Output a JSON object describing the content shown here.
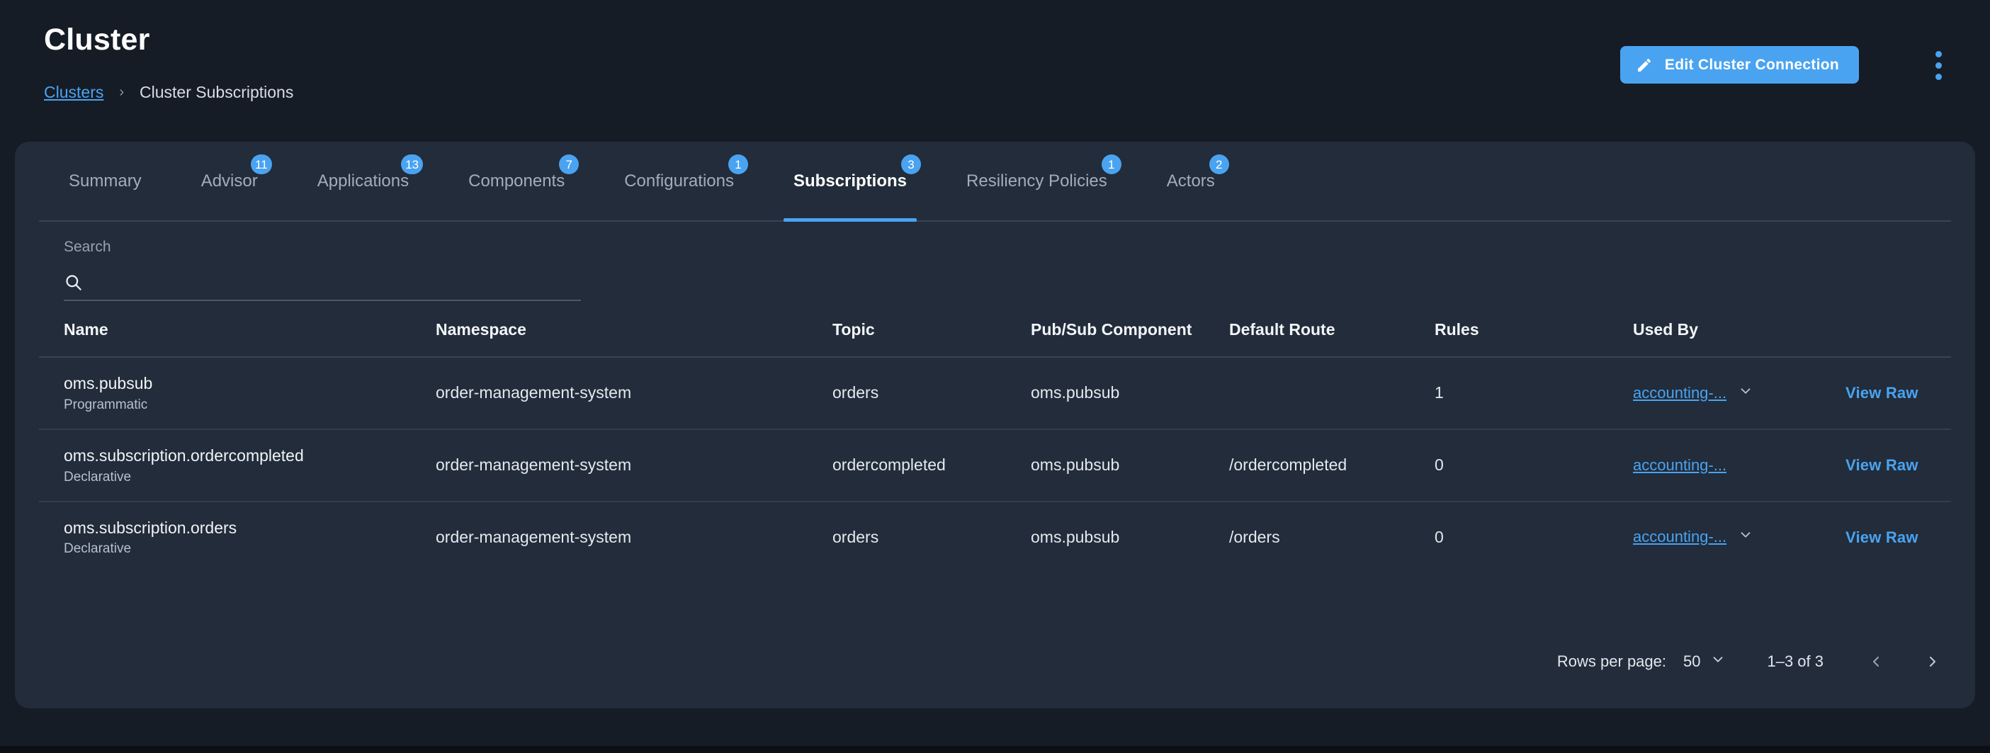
{
  "header": {
    "title": "Cluster",
    "breadcrumb": {
      "root": "Clusters",
      "separator": "›",
      "current": "Cluster Subscriptions"
    },
    "edit_button": {
      "label": "Edit Cluster Connection",
      "icon": "pencil-icon",
      "color": "#4aa3f0"
    },
    "kebab_icon": "more-vertical-icon"
  },
  "tabs": [
    {
      "label": "Summary",
      "badge": "",
      "active": false
    },
    {
      "label": "Advisor",
      "badge": "11",
      "active": false
    },
    {
      "label": "Applications",
      "badge": "13",
      "active": false
    },
    {
      "label": "Components",
      "badge": "7",
      "active": false
    },
    {
      "label": "Configurations",
      "badge": "1",
      "active": false
    },
    {
      "label": "Subscriptions",
      "badge": "3",
      "active": true
    },
    {
      "label": "Resiliency Policies",
      "badge": "1",
      "active": false
    },
    {
      "label": "Actors",
      "badge": "2",
      "active": false
    }
  ],
  "search": {
    "label": "Search",
    "value": "",
    "placeholder": "",
    "icon": "search-icon"
  },
  "table": {
    "columns": [
      "Name",
      "Namespace",
      "Topic",
      "Pub/Sub Component",
      "Default Route",
      "Rules",
      "Used By",
      ""
    ],
    "rows": [
      {
        "name": "oms.pubsub",
        "kind": "Programmatic",
        "namespace": "order-management-system",
        "topic": "orders",
        "pubsub_component": "oms.pubsub",
        "default_route": "",
        "rules": "1",
        "used_by": "accounting-...",
        "has_chevron": true,
        "view_raw": "View Raw"
      },
      {
        "name": "oms.subscription.ordercompleted",
        "kind": "Declarative",
        "namespace": "order-management-system",
        "topic": "ordercompleted",
        "pubsub_component": "oms.pubsub",
        "default_route": "/ordercompleted",
        "rules": "0",
        "used_by": "accounting-...",
        "has_chevron": false,
        "view_raw": "View Raw"
      },
      {
        "name": "oms.subscription.orders",
        "kind": "Declarative",
        "namespace": "order-management-system",
        "topic": "orders",
        "pubsub_component": "oms.pubsub",
        "default_route": "/orders",
        "rules": "0",
        "used_by": "accounting-...",
        "has_chevron": true,
        "view_raw": "View Raw"
      }
    ]
  },
  "pagination": {
    "rows_per_page_label": "Rows per page:",
    "rows_per_page_value": "50",
    "range": "1–3 of 3",
    "prev_icon": "chevron-left-icon",
    "next_icon": "chevron-right-icon"
  },
  "colors": {
    "accent": "#4aa3f0",
    "page_bg": "#161c26",
    "card_bg": "#222c3a",
    "text_primary": "#f1f4f8",
    "text_secondary": "#a3adba"
  }
}
